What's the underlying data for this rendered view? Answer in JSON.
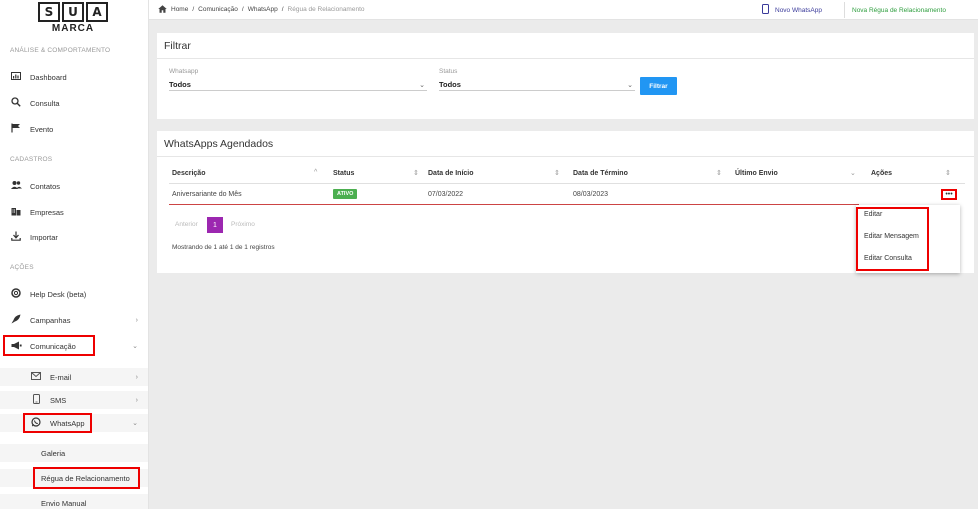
{
  "logo": {
    "letters": [
      "S",
      "U",
      "A"
    ],
    "text": "MARCA"
  },
  "sidebar": {
    "section_analise": "ANÁLISE & COMPORTAMENTO",
    "section_cadastros": "CADASTROS",
    "section_acoes": "AÇÕES",
    "dashboard": "Dashboard",
    "consulta": "Consulta",
    "evento": "Evento",
    "contatos": "Contatos",
    "empresas": "Empresas",
    "importar": "Importar",
    "helpdesk": "Help Desk (beta)",
    "campanhas": "Campanhas",
    "comunicacao": "Comunicação",
    "email": "E-mail",
    "sms": "SMS",
    "whatsapp": "WhatsApp",
    "galeria": "Galeria",
    "regua": "Régua de Relacionamento",
    "envio_manual": "Envio Manual"
  },
  "breadcrumb": {
    "home": "Home",
    "sep": "/",
    "comunicacao": "Comunicação",
    "whatsapp": "WhatsApp",
    "current": "Régua de Relacionamento"
  },
  "topbar": {
    "novo_whatsapp": "Novo WhatsApp",
    "nova_regua": "Nova Régua de Relacionamento"
  },
  "filter": {
    "title": "Filtrar",
    "whatsapp_label": "Whatsapp",
    "whatsapp_value": "Todos",
    "status_label": "Status",
    "status_value": "Todos",
    "button": "Filtrar"
  },
  "table": {
    "title": "WhatsApps Agendados",
    "headers": {
      "descricao": "Descrição",
      "status": "Status",
      "inicio": "Data de Início",
      "termino": "Data de Término",
      "ultimo": "Último Envio",
      "acoes": "Ações"
    },
    "rows": [
      {
        "descricao": "Aniversariante do Mês",
        "status": "ATIVO",
        "inicio": "07/03/2022",
        "termino": "08/03/2023",
        "ultimo": ""
      }
    ],
    "more": "•••",
    "pager": {
      "prev": "Anterior",
      "page": "1",
      "next": "Próximo"
    },
    "info": "Mostrando de 1 até 1 de 1 registros"
  },
  "menu": {
    "editar": "Editar",
    "editar_mensagem": "Editar Mensagem",
    "editar_consulta": "Editar Consulta"
  },
  "colors": {
    "accent_blue": "#2196f3",
    "active_green": "#4caf50",
    "pager_purple": "#9c27b0",
    "highlight_red": "#ee0000"
  }
}
